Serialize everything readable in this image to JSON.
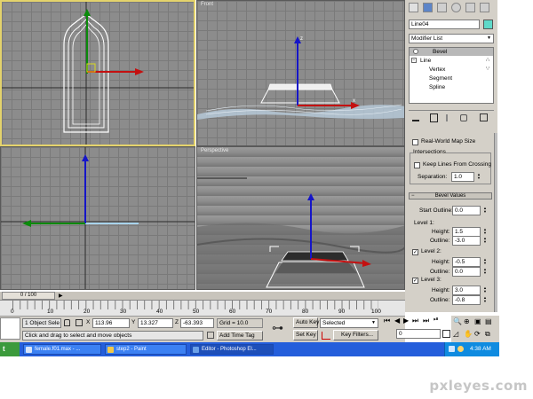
{
  "viewports": {
    "top": {
      "label": ""
    },
    "front": {
      "label": "Front"
    },
    "left": {
      "label": ""
    },
    "perspective": {
      "label": "Perspective"
    }
  },
  "axes": {
    "x": "x",
    "z": "z"
  },
  "panel": {
    "object_name": "Line04",
    "object_color": "#5fd9c9",
    "modifier_list": "Modifier List",
    "stack": [
      {
        "label": "Bevel"
      },
      {
        "label": "Line"
      },
      {
        "label": "Vertex"
      },
      {
        "label": "Segment"
      },
      {
        "label": "Spline"
      }
    ],
    "real_world_map": "Real-World Map Size",
    "intersections_title": "Intersections",
    "keep_lines": "Keep Lines From Crossing",
    "separation_label": "Separation:",
    "separation_value": "1.0",
    "bevel_values_title": "Bevel Values",
    "start_outline_label": "Start Outline:",
    "start_outline_value": "0.0",
    "level1_label": "Level 1:",
    "level1_height_label": "Height:",
    "level1_height_value": "1.5",
    "level1_outline_label": "Outline:",
    "level1_outline_value": "-3.0",
    "level2_label": "Level 2:",
    "level2_height_label": "Height:",
    "level2_height_value": "-0.5",
    "level2_outline_label": "Outline:",
    "level2_outline_value": "0.0",
    "level3_label": "Level 3:",
    "level3_height_label": "Height:",
    "level3_height_value": "3.0",
    "level3_outline_label": "Outline:",
    "level3_outline_value": "-0.8"
  },
  "timeline": {
    "frame_counter": "0 / 100",
    "ticks": [
      "0",
      "10",
      "20",
      "30",
      "40",
      "50",
      "60",
      "70",
      "80",
      "90",
      "100"
    ]
  },
  "status": {
    "selection": "1 Object Sele",
    "x_label": "X",
    "x_value": "113.96",
    "y_label": "Y",
    "y_value": "13.327",
    "z_label": "Z",
    "z_value": "-63.393",
    "grid": "Grid = 10.0",
    "prompt": "Click and drag to select and move objects",
    "add_time_tag": "Add Time Tag",
    "auto_key": "Auto Key",
    "set_key": "Set Key",
    "selected_dropdown": "Selected",
    "key_filters": "Key Filters...",
    "current_frame": "0"
  },
  "taskbar": {
    "start": "t",
    "items": [
      "female.f01.max - ...",
      "step2 - Paint",
      "Editor - Photoshop El..."
    ],
    "clock": "4:38 AM"
  },
  "watermark": "pxleyes.com"
}
